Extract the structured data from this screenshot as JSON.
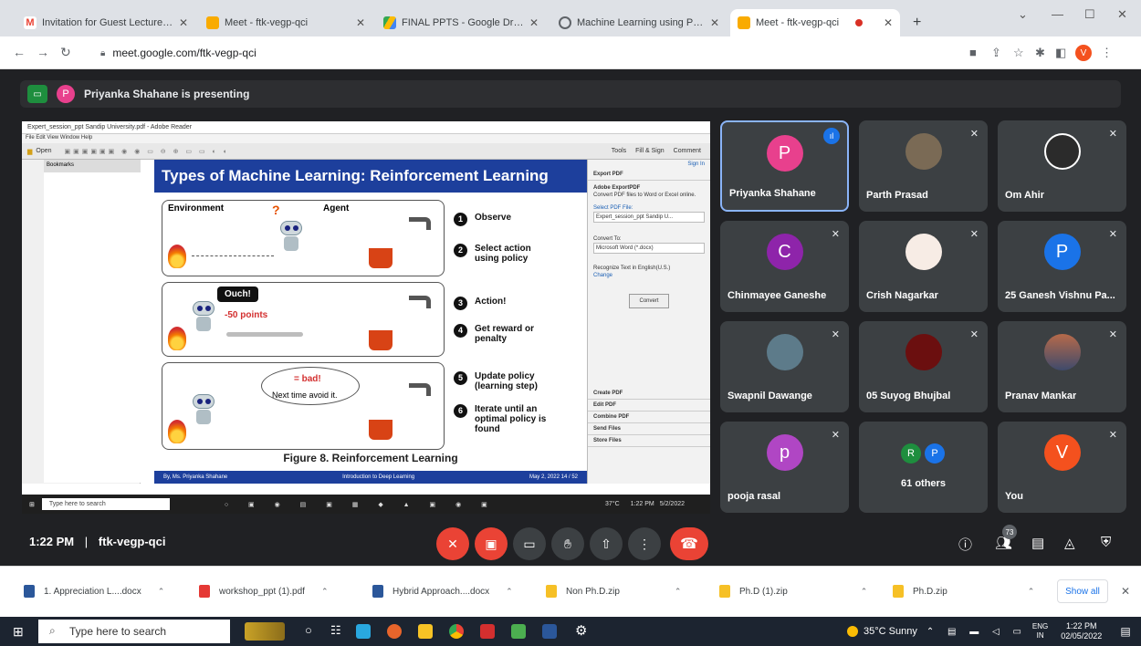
{
  "browser": {
    "tabs": [
      {
        "title": "Invitation for Guest Lecture on D",
        "color": "#ea4335"
      },
      {
        "title": "Meet - ftk-vegp-qci",
        "color": "#f9ab00"
      },
      {
        "title": "FINAL PPTS - Google Drive",
        "color": "#34a853"
      },
      {
        "title": "Machine Learning using Python",
        "color": "#5f6368"
      },
      {
        "title": "Meet - ftk-vegp-qci",
        "color": "#f9ab00"
      }
    ],
    "new_tab": "+",
    "url": "meet.google.com/ftk-vegp-qci",
    "profile_initial": "V"
  },
  "meet": {
    "presenter_initial": "P",
    "presenting_text": "Priyanka Shahane is presenting",
    "meeting_time": "1:22 PM",
    "separator": "|",
    "meeting_code": "ftk-vegp-qci",
    "people_count": "73",
    "participants": [
      {
        "name": "Priyanka Shahane",
        "initial": "P",
        "color": "#e8408d",
        "active": true
      },
      {
        "name": "Parth Prasad",
        "initial": "",
        "color": "#7a6a55",
        "active": false
      },
      {
        "name": "Om Ahir",
        "initial": "",
        "color": "#2b2b2b",
        "active": false
      },
      {
        "name": "Chinmayee Ganeshe",
        "initial": "C",
        "color": "#8e24aa",
        "active": false
      },
      {
        "name": "Crish Nagarkar",
        "initial": "",
        "color": "#f7ece5",
        "active": false
      },
      {
        "name": "25 Ganesh Vishnu Pa...",
        "initial": "P",
        "color": "#1a73e8",
        "active": false
      },
      {
        "name": "Swapnil Dawange",
        "initial": "",
        "color": "#5d7b8a",
        "active": false
      },
      {
        "name": "05 Suyog Bhujbal",
        "initial": "",
        "color": "#6b0f0f",
        "active": false
      },
      {
        "name": "Pranav Mankar",
        "initial": "",
        "color": "#b66a4a",
        "active": false
      },
      {
        "name": "pooja rasal",
        "initial": "p",
        "color": "#b046c4",
        "active": false
      },
      {
        "name": "61 others",
        "initial": "",
        "color": "",
        "active": false
      },
      {
        "name": "You",
        "initial": "V",
        "color": "#f4511e",
        "active": false
      }
    ],
    "others_initials": [
      "R",
      "P"
    ]
  },
  "screen": {
    "reader_title": "Expert_session_ppt Sandip University.pdf - Adobe Reader",
    "reader_menu": "File  Edit  View  Window  Help",
    "reader_open": "Open",
    "reader_tools": [
      "Tools",
      "Fill & Sign",
      "Comment"
    ],
    "bookmarks_label": "Bookmarks",
    "slide_title": "Types of Machine Learning: Reinforcement Learning",
    "environment_label": "Environment",
    "agent_label": "Agent",
    "ouch": "Ouch!",
    "points": "-50 points",
    "bad": "= bad!",
    "next_time": "Next time avoid it.",
    "steps": [
      {
        "n": "1",
        "text": "Observe"
      },
      {
        "n": "2",
        "text": "Select action using policy"
      },
      {
        "n": "3",
        "text": "Action!"
      },
      {
        "n": "4",
        "text": "Get reward or penalty"
      },
      {
        "n": "5",
        "text": "Update policy (learning step)"
      },
      {
        "n": "6",
        "text": "Iterate until an optimal policy is found"
      }
    ],
    "figure_caption": "Figure 8.  Reinforcement Learning",
    "footer_left": "By, Ms. Priyanka Shahane",
    "footer_mid": "Introduction to Deep Learning",
    "footer_right": "May 2, 2022     14 / 52",
    "right_panel": {
      "sign_in": "Sign In",
      "export_header": "Export PDF",
      "export_title": "Adobe ExportPDF",
      "export_desc": "Convert PDF files to Word or Excel online.",
      "select_label": "Select PDF File:",
      "selected_file": "Expert_session_ppt Sandip U...",
      "convert_to": "Convert To:",
      "format": "Microsoft Word (*.docx)",
      "recognize": "Recognize Text in English(U.S.)",
      "change": "Change",
      "convert_btn": "Convert",
      "sections": [
        "Create PDF",
        "Edit PDF",
        "Combine PDF",
        "Send Files",
        "Store Files"
      ]
    },
    "inner_taskbar": {
      "search": "Type here to search",
      "weather": "37°C",
      "time": "1:22 PM",
      "date": "5/2/2022"
    }
  },
  "downloads": [
    {
      "name": "1. Appreciation L....docx",
      "color": "#2b579a"
    },
    {
      "name": "workshop_ppt (1).pdf",
      "color": "#e53935"
    },
    {
      "name": "Hybrid Approach....docx",
      "color": "#2b579a"
    },
    {
      "name": "Non Ph.D.zip",
      "color": "#f6c026"
    },
    {
      "name": "Ph.D (1).zip",
      "color": "#f6c026"
    },
    {
      "name": "Ph.D.zip",
      "color": "#f6c026"
    }
  ],
  "show_all": "Show all",
  "taskbar": {
    "search_placeholder": "Type here to search",
    "weather": "35°C  Sunny",
    "lang_top": "ENG",
    "lang_bottom": "IN",
    "time": "1:22 PM",
    "date": "02/05/2022"
  }
}
